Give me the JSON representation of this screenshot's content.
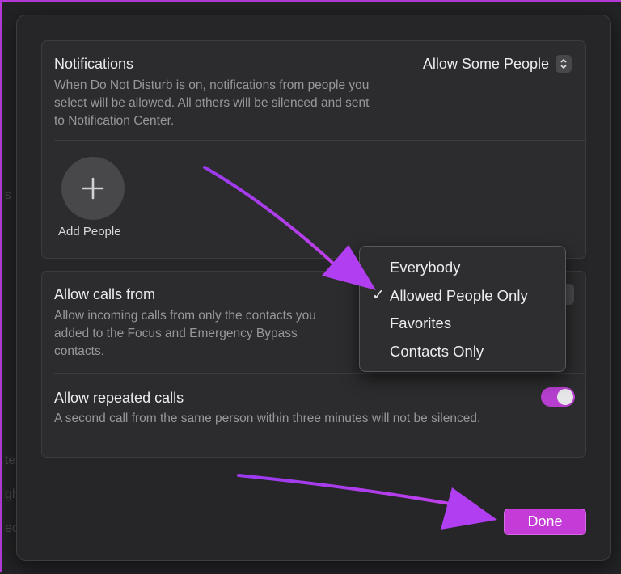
{
  "notifications": {
    "title": "Notifications",
    "description": "When Do Not Disturb is on, notifications from people you select will be allowed. All others will be silenced and sent to Notification Center.",
    "selector_value": "Allow Some People",
    "add_people_label": "Add People"
  },
  "calls": {
    "allow_calls_title": "Allow calls from",
    "allow_calls_description": "Allow incoming calls from only the contacts you added to the Focus and Emergency Bypass contacts.",
    "repeated_title": "Allow repeated calls",
    "repeated_description": "A second call from the same person within three minutes will not be silenced.",
    "repeated_enabled": true
  },
  "calls_menu": {
    "options": [
      "Everybody",
      "Allowed People Only",
      "Favorites",
      "Contacts Only"
    ],
    "selected": "Allowed People Only",
    "check_glyph": "✓"
  },
  "footer": {
    "done_label": "Done"
  },
  "colors": {
    "accent": "#c43bd8",
    "annotation_arrow": "#a43cf0",
    "border_frame": "#b33ad6"
  },
  "icons": {
    "add": "plus-icon",
    "stepper": "up-down-chevron-icon",
    "check": "checkmark-icon"
  }
}
